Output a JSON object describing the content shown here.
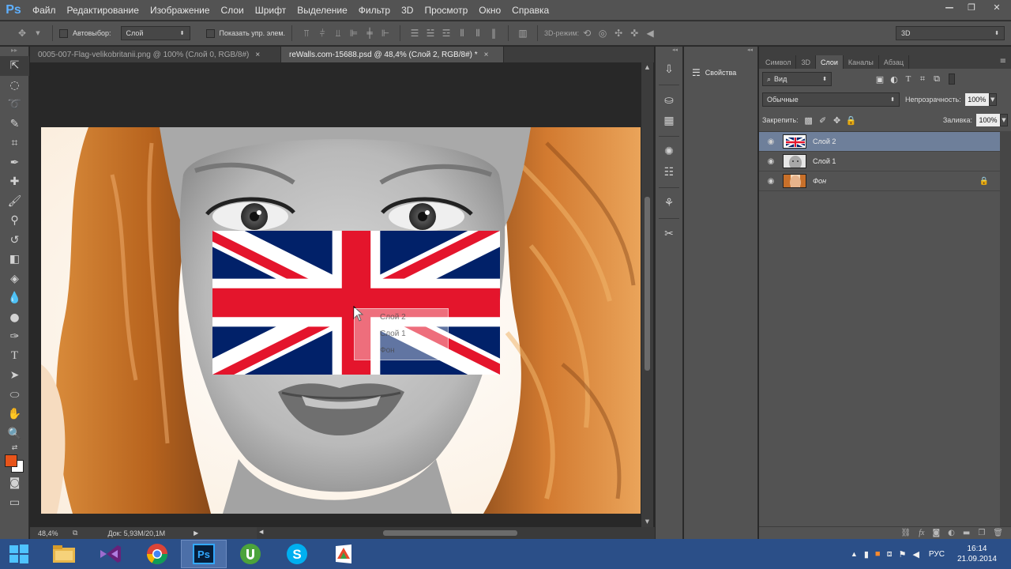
{
  "menu": {
    "logo": "Ps",
    "items": [
      "Файл",
      "Редактирование",
      "Изображение",
      "Слои",
      "Шрифт",
      "Выделение",
      "Фильтр",
      "3D",
      "Просмотр",
      "Окно",
      "Справка"
    ]
  },
  "options": {
    "autoselect_label": "Автовыбор:",
    "autoselect_value": "Слой",
    "show_controls_label": "Показать упр. элем.",
    "mode_3d_label": "3D-режим:",
    "workspace_value": "3D"
  },
  "tabs": [
    {
      "label": "0005-007-Flag-velikobritanii.png @ 100% (Слой 0, RGB/8#)",
      "close": "×"
    },
    {
      "label": "reWalls.com-15688.psd @ 48,4% (Слой 2, RGB/8#) *",
      "close": "×"
    }
  ],
  "status": {
    "zoom": "48,4%",
    "doc_info": "Док: 5,93M/20,1M"
  },
  "drag_tooltip": [
    "Слой 2",
    "Слой 1",
    "Фон"
  ],
  "properties_panel": {
    "label": "Свойства"
  },
  "layers_panel": {
    "tabs": [
      "Символ",
      "3D",
      "Слои",
      "Каналы",
      "Абзац"
    ],
    "active_tab": "Слои",
    "filter_value": "Вид",
    "blend_mode": "Обычные",
    "opacity_label": "Непрозрачность:",
    "opacity_value": "100%",
    "lock_label": "Закрепить:",
    "fill_label": "Заливка:",
    "fill_value": "100%",
    "layers": [
      {
        "name": "Слой 2",
        "selected": true,
        "locked": false,
        "italic": false
      },
      {
        "name": "Слой 1",
        "selected": false,
        "locked": false,
        "italic": false
      },
      {
        "name": "Фон",
        "selected": false,
        "locked": true,
        "italic": true
      }
    ]
  },
  "taskbar": {
    "apps": [
      "file-explorer",
      "visual-studio",
      "chrome",
      "photoshop",
      "utorrent",
      "skype",
      "office"
    ],
    "active_app": "photoshop",
    "language": "РУС",
    "time": "16:14",
    "date": "21.09.2014"
  },
  "colors": {
    "foreground": "#e8541a",
    "background": "#ffffff",
    "flag_blue": "#012169",
    "flag_red": "#e4152c",
    "selected_layer": "#6e7f9a"
  }
}
